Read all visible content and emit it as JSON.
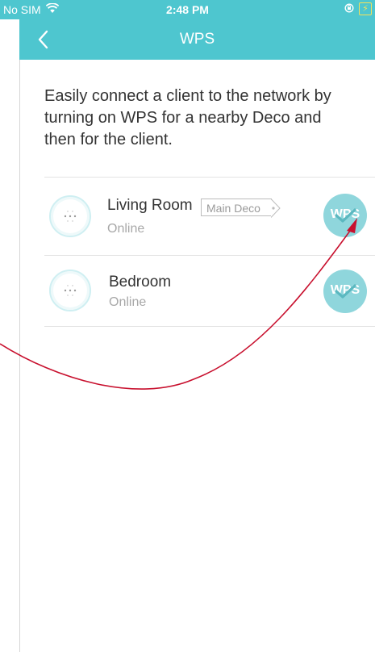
{
  "status_bar": {
    "carrier": "No SIM",
    "time": "2:48 PM",
    "icons": [
      "wifi-icon",
      "orientation-lock-icon",
      "battery-charging-icon"
    ]
  },
  "nav": {
    "back_icon": "chevron-left-icon",
    "title": "WPS"
  },
  "description": "Easily connect a client to the network by turning on WPS for a nearby Deco and then for the client.",
  "devices": [
    {
      "name": "Living Room",
      "tag": "Main Deco",
      "status": "Online",
      "wps_label": "WPS",
      "wps_state": "checked"
    },
    {
      "name": "Bedroom",
      "status": "Online",
      "wps_label": "WPS",
      "wps_state": "checked"
    }
  ],
  "colors": {
    "header": "#4ec6cf",
    "wps_button": "#8fd6dc",
    "annotation_arrow": "#c8102e",
    "battery": "#f5e15a"
  }
}
